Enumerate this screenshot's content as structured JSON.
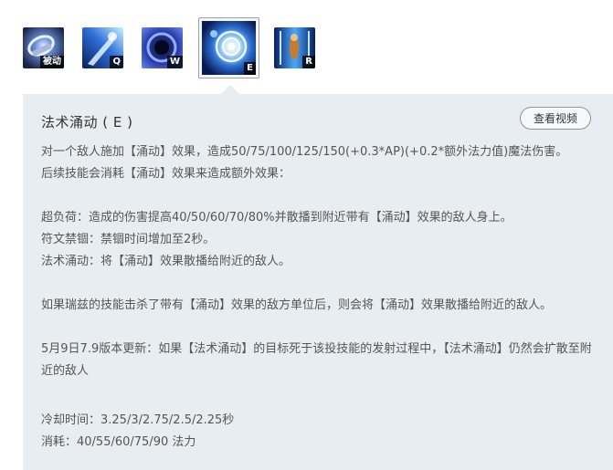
{
  "skills": [
    {
      "key": "被动",
      "icon": "passive-skill-icon"
    },
    {
      "key": "Q",
      "icon": "q-skill-icon"
    },
    {
      "key": "W",
      "icon": "w-skill-icon"
    },
    {
      "key": "E",
      "icon": "e-skill-icon",
      "selected": true
    },
    {
      "key": "R",
      "icon": "r-skill-icon"
    }
  ],
  "panel": {
    "title": "法术涌动 ( E )",
    "video_button": "查看视频",
    "lines": {
      "l1": "对一个敌人施加【涌动】效果，造成50/75/100/125/150(+0.3*AP)(+0.2*额外法力值)魔法伤害。",
      "l2": "后续技能会消耗【涌动】效果来造成额外效果：",
      "l3": "超负荷：造成的伤害提高40/50/60/70/80%并散播到附近带有【涌动】效果的敌人身上。",
      "l4": "符文禁锢：禁锢时间增加至2秒。",
      "l5": "法术涌动：将【涌动】效果散播给附近的敌人。",
      "l6": "如果瑞兹的技能击杀了带有【涌动】效果的敌方单位后，则会将【涌动】效果散播给附近的敌人。",
      "l7": "5月9日7.9版本更新：如果【法术涌动】的目标死于该投技能的发射过程中，【法术涌动】仍然会扩散至附近的敌人",
      "l8": "冷却时间：3.25/3/2.75/2.5/2.25秒",
      "l9": "消耗：40/55/60/75/90 法力"
    }
  },
  "colors": {
    "panel_bg": "#e8edf2",
    "text": "#555555",
    "title": "#333333"
  }
}
